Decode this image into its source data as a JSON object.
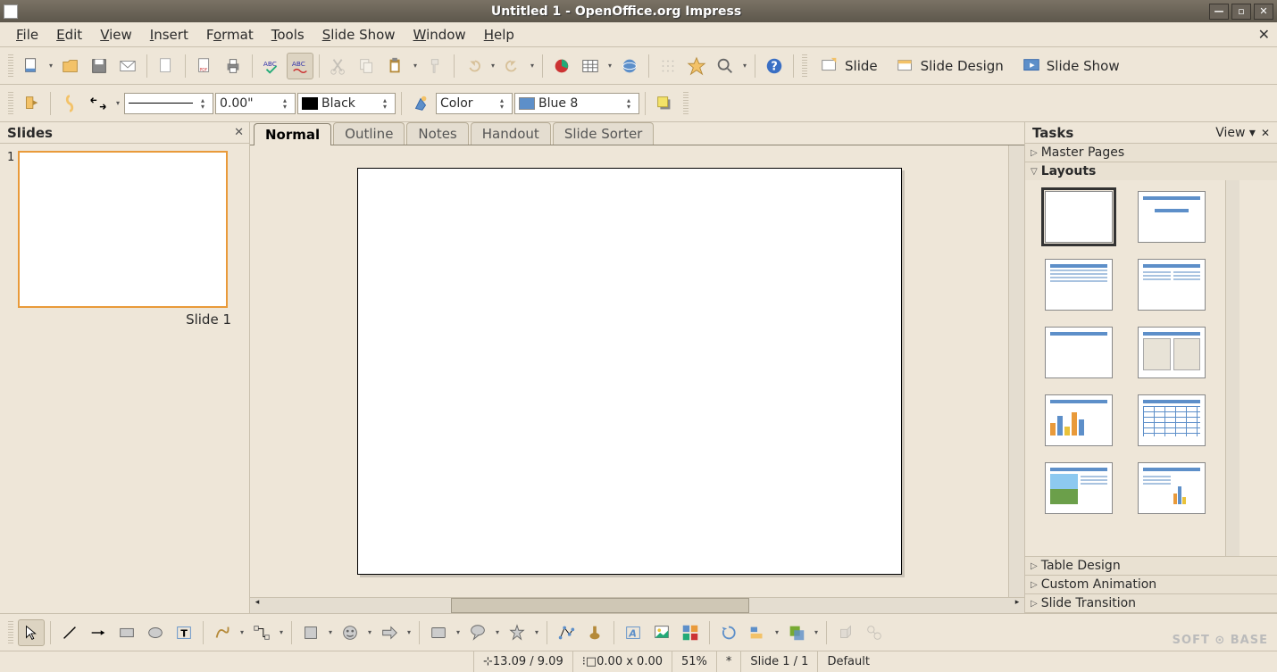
{
  "window": {
    "title": "Untitled 1 - OpenOffice.org Impress"
  },
  "menu": {
    "items": [
      "File",
      "Edit",
      "View",
      "Insert",
      "Format",
      "Tools",
      "Slide Show",
      "Window",
      "Help"
    ]
  },
  "toolbar_right": {
    "slide": "Slide",
    "slide_design": "Slide Design",
    "slide_show": "Slide Show"
  },
  "toolbar2": {
    "line_width": "0.00\"",
    "fill_label": "Black",
    "color_style": "Color",
    "color_value": "Blue 8"
  },
  "slides_panel": {
    "title": "Slides",
    "slide_number": "1",
    "slide_label": "Slide 1"
  },
  "view_tabs": [
    "Normal",
    "Outline",
    "Notes",
    "Handout",
    "Slide Sorter"
  ],
  "tasks_panel": {
    "title": "Tasks",
    "view_menu": "View",
    "sections": {
      "master_pages": "Master Pages",
      "layouts": "Layouts",
      "table_design": "Table Design",
      "custom_animation": "Custom Animation",
      "slide_transition": "Slide Transition"
    }
  },
  "status": {
    "position": "13.09 / 9.09",
    "size": "0.00 x 0.00",
    "zoom": "51%",
    "modified": "*",
    "slide_count": "Slide 1 / 1",
    "layout": "Default"
  },
  "watermark": "SOFT ⊙ BASE"
}
